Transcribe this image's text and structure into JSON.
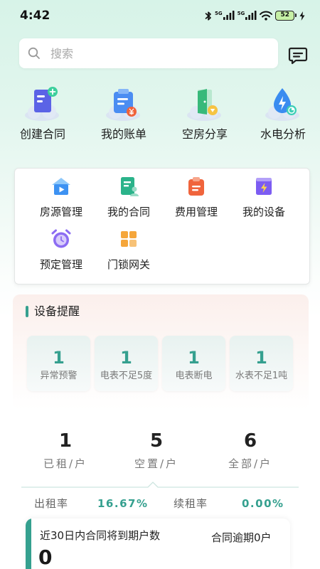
{
  "status_bar": {
    "time": "4:42",
    "network_1": "5G",
    "network_2": "5G",
    "battery": "52"
  },
  "search": {
    "placeholder": "搜索",
    "value": ""
  },
  "quick_actions": [
    {
      "label": "创建合同",
      "icon": "create-contract-icon"
    },
    {
      "label": "我的账单",
      "icon": "bill-icon"
    },
    {
      "label": "空房分享",
      "icon": "vacant-room-share-icon"
    },
    {
      "label": "水电分析",
      "icon": "utility-analysis-icon"
    }
  ],
  "menu": [
    {
      "label": "房源管理",
      "icon": "house-icon"
    },
    {
      "label": "我的合同",
      "icon": "contract-icon"
    },
    {
      "label": "费用管理",
      "icon": "fee-icon"
    },
    {
      "label": "我的设备",
      "icon": "device-icon"
    },
    {
      "label": "预定管理",
      "icon": "alarm-clock-icon"
    },
    {
      "label": "门锁网关",
      "icon": "grid-icon"
    }
  ],
  "device_alerts": {
    "title": "设备提醒",
    "items": [
      {
        "count": "1",
        "label": "异常预警"
      },
      {
        "count": "1",
        "label": "电表不足5度"
      },
      {
        "count": "1",
        "label": "电表断电"
      },
      {
        "count": "1",
        "label": "水表不足1吨"
      }
    ]
  },
  "stats": [
    {
      "value": "1",
      "label": "已租/户"
    },
    {
      "value": "5",
      "label": "空置/户"
    },
    {
      "value": "6",
      "label": "全部/户"
    }
  ],
  "rates": {
    "occupancy_label": "出租率",
    "occupancy_value": "16.67%",
    "renewal_label": "续租率",
    "renewal_value": "0.00%"
  },
  "expiring_contracts": {
    "title": "近30日内合同将到期户数",
    "overdue": "合同逾期0户",
    "count": "0"
  },
  "colors": {
    "accent": "#35a08f",
    "background_top": "#d7f3e8"
  }
}
